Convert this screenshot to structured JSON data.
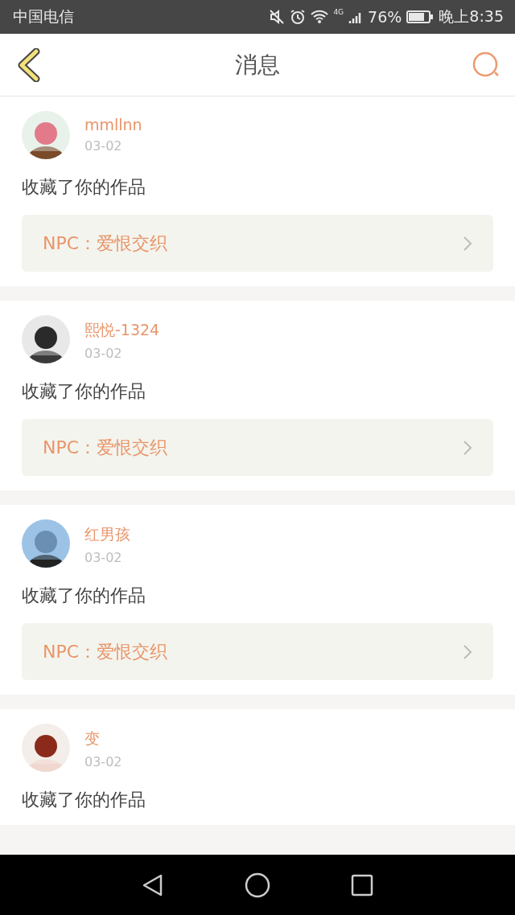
{
  "status_bar": {
    "carrier": "中国电信",
    "network": "4G",
    "battery": "76%",
    "time": "晚上8:35"
  },
  "header": {
    "title": "消息"
  },
  "messages": [
    {
      "user": "mmllnn",
      "date": "03-02",
      "text": "收藏了你的作品",
      "link": "NPC：爱恨交织"
    },
    {
      "user": "熙悦-1324",
      "date": "03-02",
      "text": "收藏了你的作品",
      "link": "NPC：爱恨交织"
    },
    {
      "user": "红男孩",
      "date": "03-02",
      "text": "收藏了你的作品",
      "link": "NPC：爱恨交织"
    },
    {
      "user": "变",
      "date": "03-02",
      "text": "收藏了你的作品"
    }
  ]
}
